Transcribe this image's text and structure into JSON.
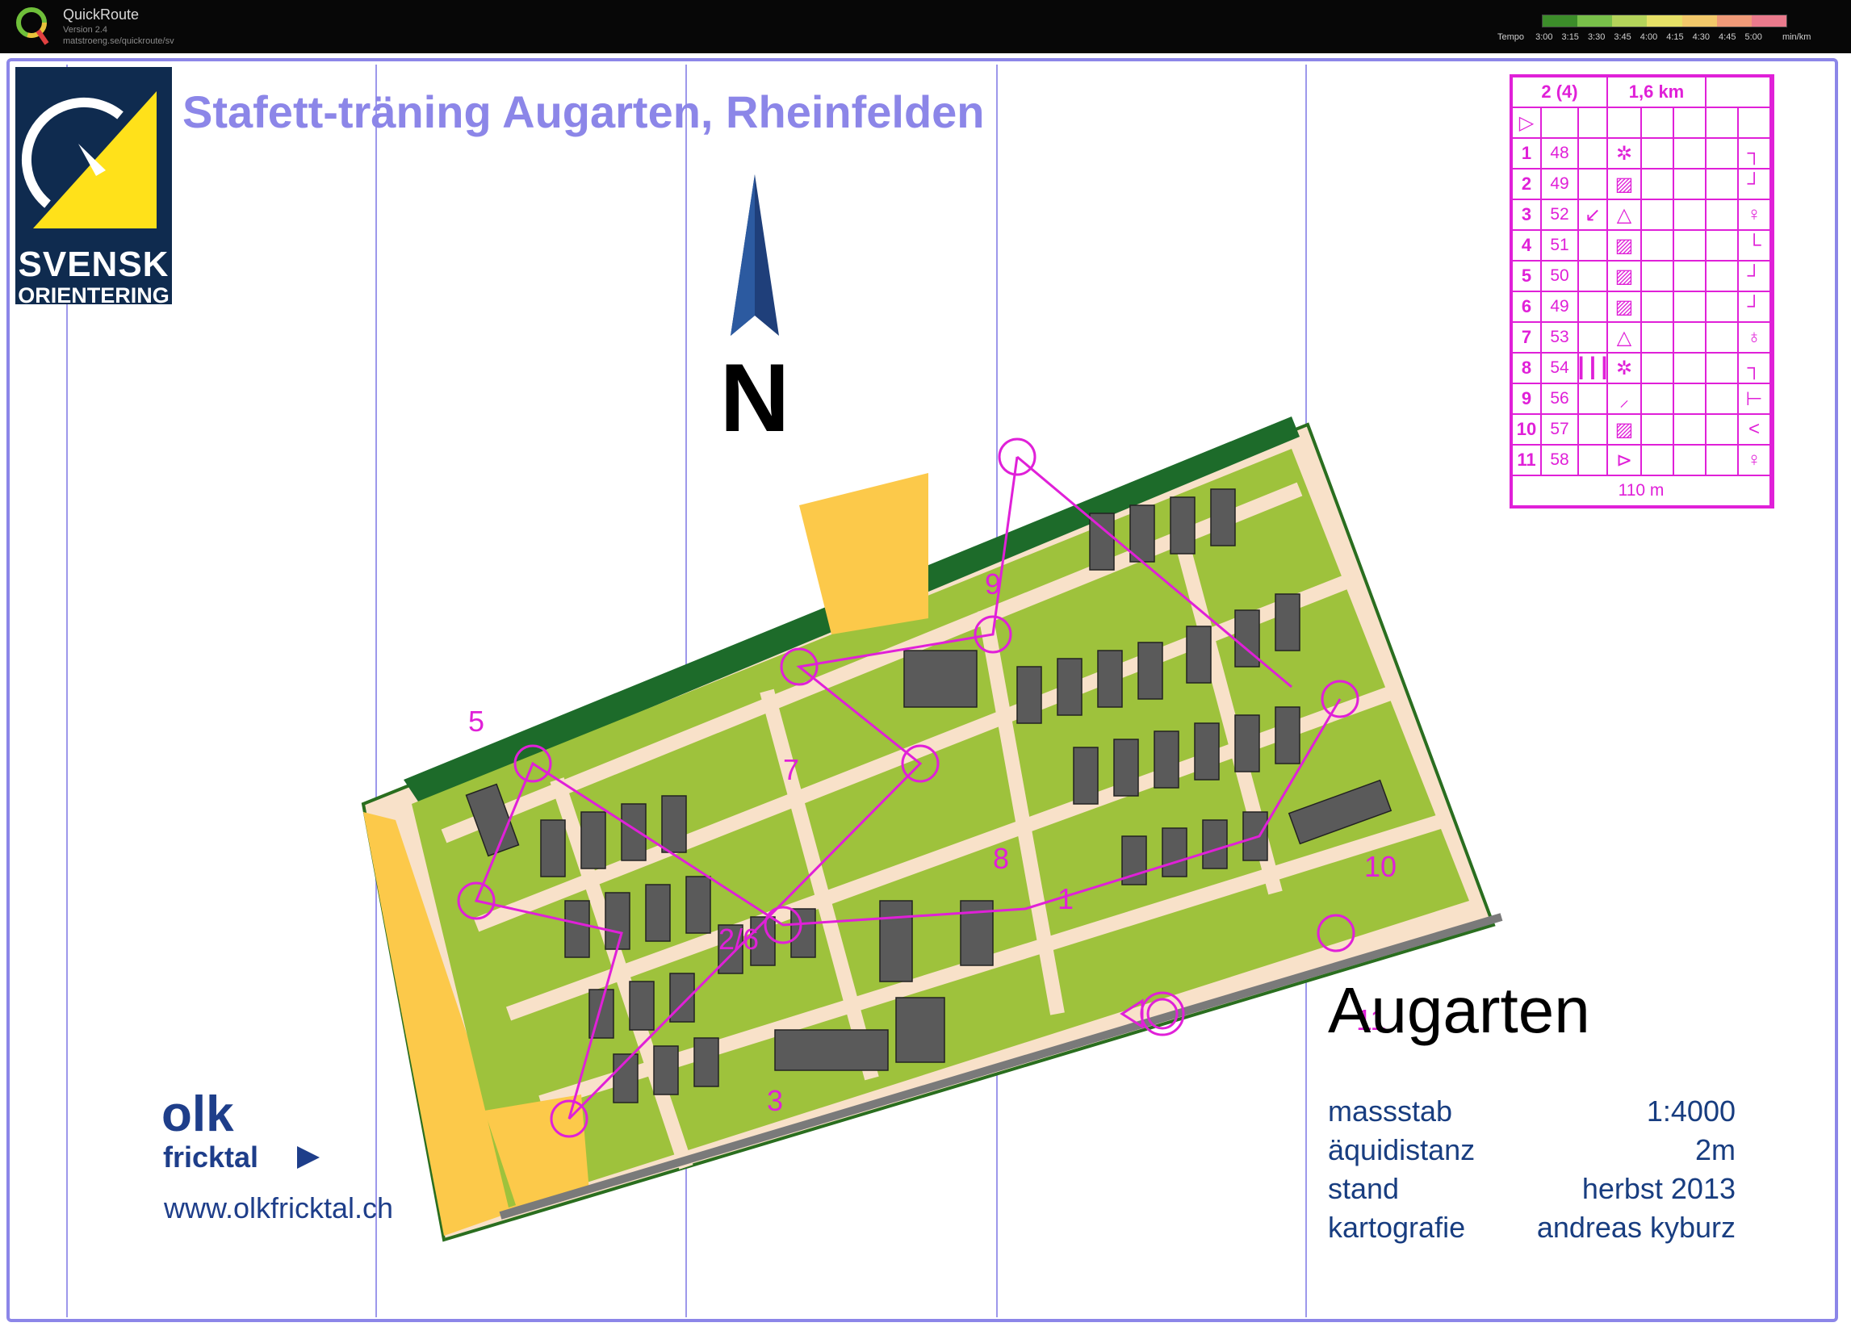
{
  "app": {
    "name": "QuickRoute",
    "version": "Version 2.4",
    "url": "matstroeng.se/quickroute/sv"
  },
  "tempo": {
    "label": "Tempo",
    "ticks": [
      "3:00",
      "3:15",
      "3:30",
      "3:45",
      "4:00",
      "4:15",
      "4:30",
      "4:45",
      "5:00"
    ],
    "unit": "min/km",
    "colors": [
      "#3c8d2a",
      "#79c04a",
      "#b4d35a",
      "#e6e066",
      "#f2c86a",
      "#f09a78",
      "#ea7a8c"
    ]
  },
  "map": {
    "title": "Stafett-träning Augarten, Rheinfelden",
    "name": "Augarten",
    "logo_text_1": "SVENSK",
    "logo_text_2": "ORIENTERING",
    "north_label": "N",
    "info": [
      {
        "label": "massstab",
        "value": "1:4000"
      },
      {
        "label": "äquidistanz",
        "value": "2m"
      },
      {
        "label": "stand",
        "value": "herbst 2013"
      },
      {
        "label": "kartografie",
        "value": "andreas kyburz"
      }
    ],
    "club_logo_line1": "olk",
    "club_logo_line2": "fricktal",
    "club_url": "www.olkfricktal.ch",
    "colors": {
      "course": "#e020d8",
      "meridian": "#8c86e8",
      "building": "#5a5a5a",
      "open": "#fcc94a",
      "vegetation": "#9ec23c",
      "paved": "#f8e1c9"
    }
  },
  "course": {
    "class": "2 (4)",
    "length": "1,6 km",
    "finish_distance": "110 m",
    "controls": [
      {
        "num": "1",
        "code": "48",
        "feature": "✲",
        "extra": "┐"
      },
      {
        "num": "2",
        "code": "49",
        "feature": "▨",
        "extra": "┘"
      },
      {
        "num": "3",
        "code": "52",
        "dir": "↙",
        "feature": "△",
        "extra": "♀"
      },
      {
        "num": "4",
        "code": "51",
        "feature": "▨",
        "extra": "└"
      },
      {
        "num": "5",
        "code": "50",
        "feature": "▨",
        "extra": "┘"
      },
      {
        "num": "6",
        "code": "49",
        "feature": "▨",
        "extra": "┘"
      },
      {
        "num": "7",
        "code": "53",
        "feature": "△",
        "extra": "♁"
      },
      {
        "num": "8",
        "code": "54",
        "dir": "┃┃┃",
        "feature": "✲",
        "extra": "┐"
      },
      {
        "num": "9",
        "code": "56",
        "feature": "⸝",
        "extra": "⊢"
      },
      {
        "num": "10",
        "code": "57",
        "feature": "▨",
        "extra": "<"
      },
      {
        "num": "11",
        "code": "58",
        "feature": "⊳",
        "extra": "♀"
      }
    ],
    "map_labels": [
      "1",
      "2/6",
      "3",
      "4",
      "5",
      "7",
      "8",
      "9",
      "10",
      "11"
    ]
  }
}
